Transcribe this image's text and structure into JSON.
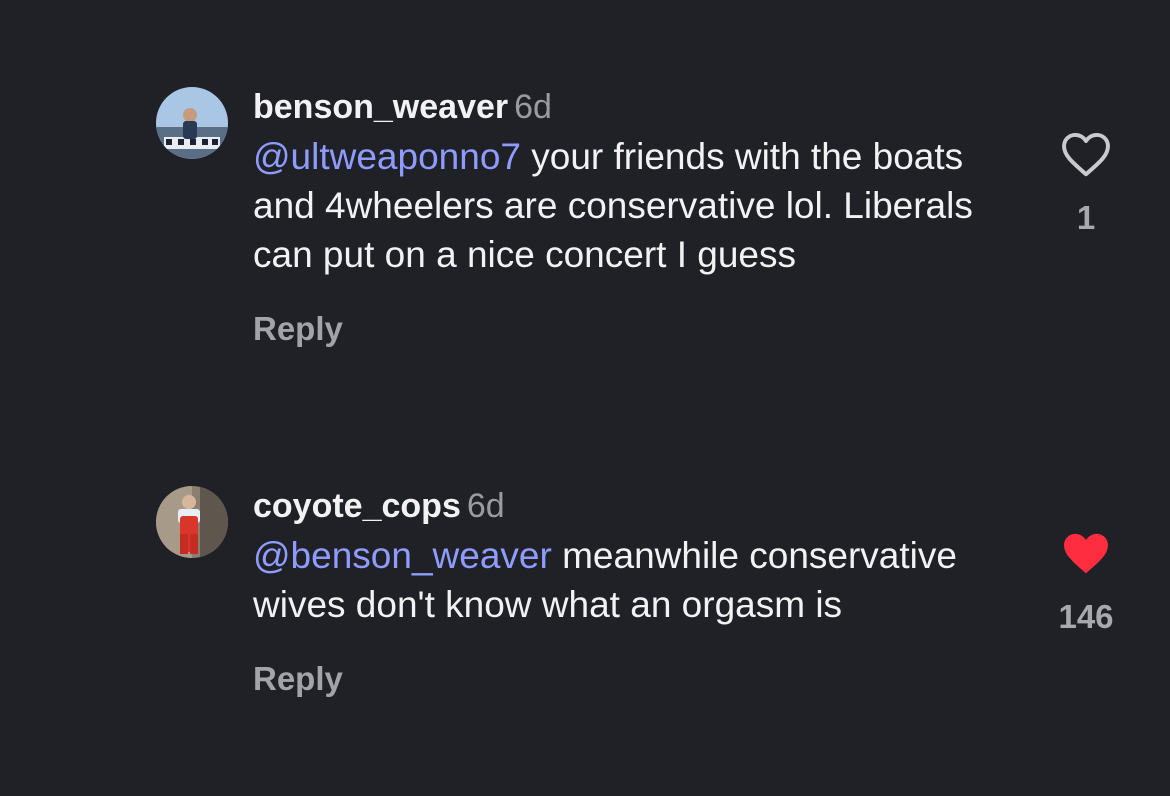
{
  "comments": [
    {
      "username": "benson_weaver",
      "time": "6d",
      "mention": "@ultweaponno7",
      "text": " your friends with the boats and 4wheelers are conservative lol. Liberals can put on a nice concert I guess",
      "reply_label": "Reply",
      "like_count": "1",
      "liked": false
    },
    {
      "username": "coyote_cops",
      "time": "6d",
      "mention": "@benson_weaver",
      "text": " meanwhile conservative wives don't know what an orgasm is",
      "reply_label": "Reply",
      "like_count": "146",
      "liked": true
    }
  ],
  "colors": {
    "background": "#202126",
    "mention": "#8e9cff",
    "liked_heart": "#ff2d3f",
    "muted": "#9a9ba0"
  },
  "icons": {
    "like_outline": "heart-outline-icon",
    "like_filled": "heart-filled-icon"
  }
}
